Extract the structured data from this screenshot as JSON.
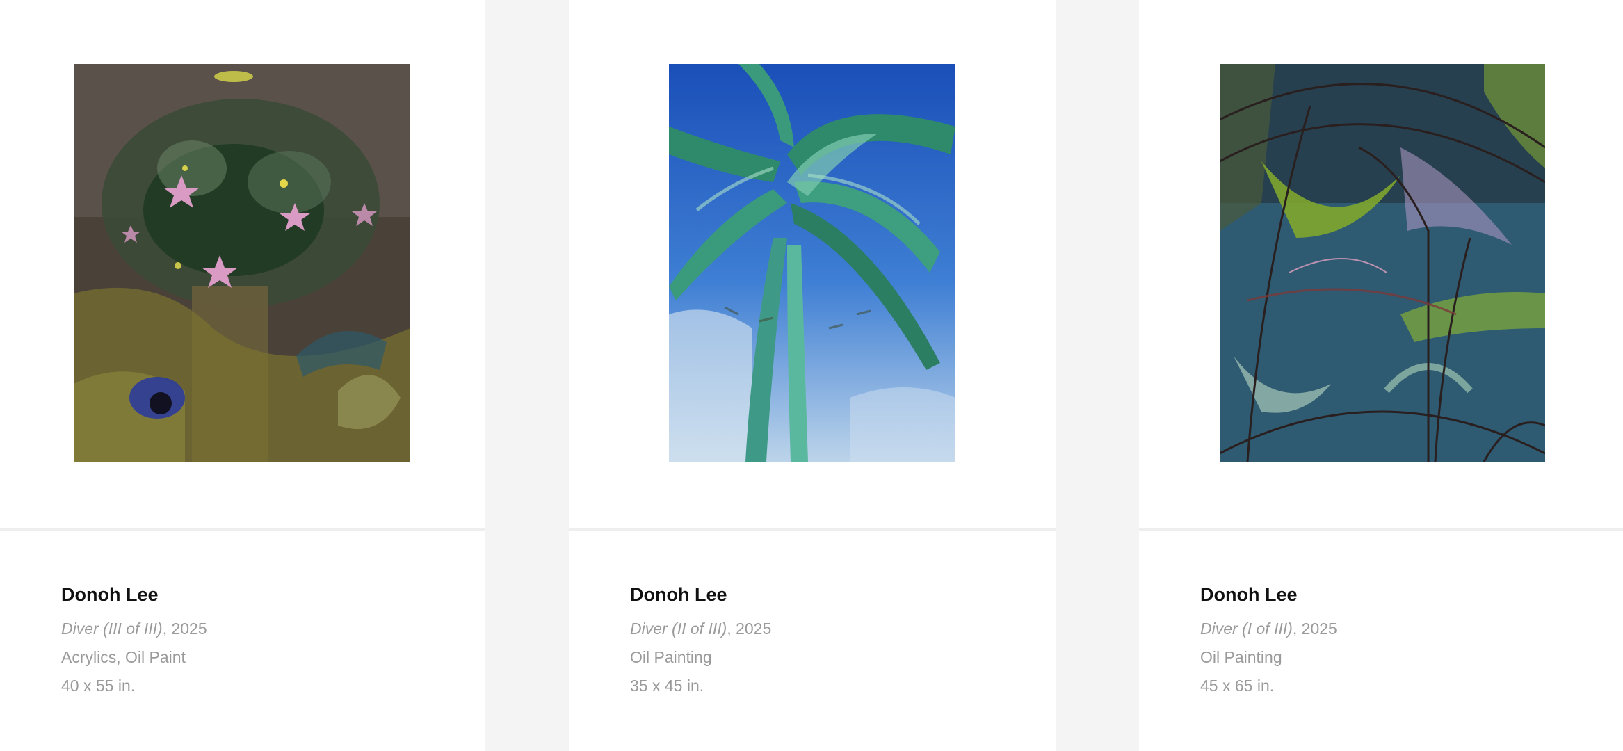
{
  "artworks": [
    {
      "artist": "Donoh Lee",
      "title": "Diver (III of III)",
      "year_suffix": ", 2025",
      "medium": "Acrylics, Oil Paint",
      "dimensions": "40 x 55 in."
    },
    {
      "artist": "Donoh Lee",
      "title": "Diver (II of III)",
      "year_suffix": ", 2025",
      "medium": "Oil Painting",
      "dimensions": "35 x 45 in."
    },
    {
      "artist": "Donoh Lee",
      "title": "Diver (I of III)",
      "year_suffix": ", 2025",
      "medium": "Oil Painting",
      "dimensions": "45 x 65 in."
    }
  ],
  "colors": {
    "page_background": "#f4f4f4",
    "card_background": "#ffffff",
    "artist_text": "#111111",
    "meta_text": "#9a9a9a"
  }
}
